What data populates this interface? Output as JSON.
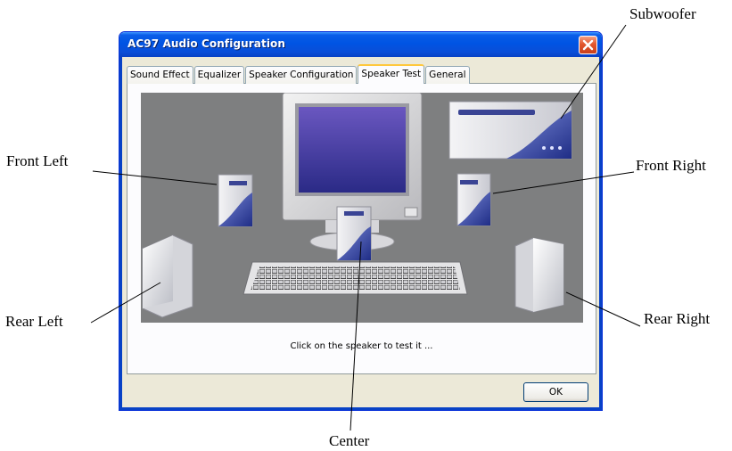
{
  "window": {
    "title": "AC97 Audio Configuration"
  },
  "tabs": [
    {
      "label": "Sound Effect"
    },
    {
      "label": "Equalizer"
    },
    {
      "label": "Speaker Configuration"
    },
    {
      "label": "Speaker Test",
      "active": true
    },
    {
      "label": "General"
    }
  ],
  "stage": {
    "status_text": "Click on the speaker to test it ..."
  },
  "buttons": {
    "ok_label": "OK"
  },
  "callouts": {
    "subwoofer": "Subwoofer",
    "front_left": "Front Left",
    "front_right": "Front Right",
    "rear_left": "Rear Left",
    "rear_right": "Rear Right",
    "center": "Center"
  },
  "colors": {
    "titlebar_blue": "#0054e3",
    "window_face": "#ece9d8",
    "close_red": "#e2562d",
    "stage_gray": "#7e7f80",
    "speaker_blue": "#2f3f9a",
    "monitor_screen": "#4a3e9e",
    "active_tab_accent": "#ffc83c"
  },
  "icons": {
    "close": "close-icon",
    "speaker": "speaker-icon",
    "subwoofer": "subwoofer-icon",
    "monitor": "monitor-icon",
    "keyboard": "keyboard-icon"
  }
}
